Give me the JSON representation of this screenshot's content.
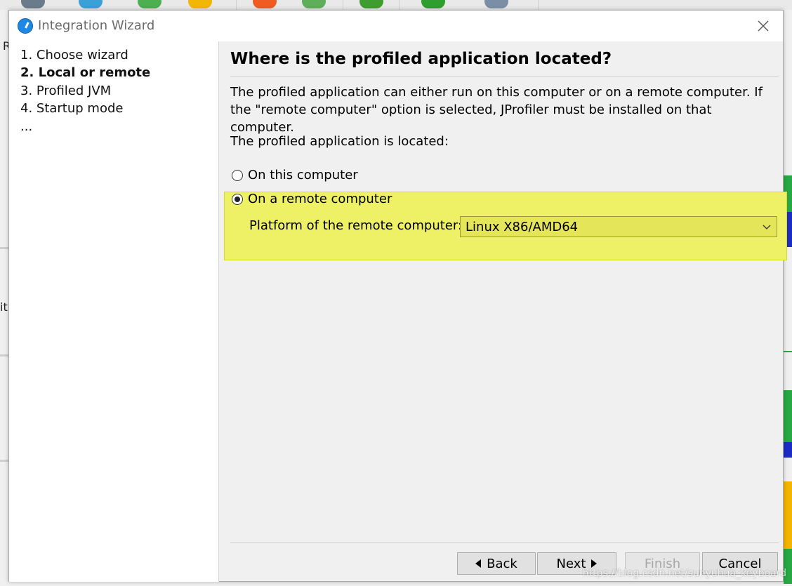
{
  "window": {
    "title": "Integration Wizard"
  },
  "steps": [
    {
      "label": "1. Choose wizard",
      "current": false
    },
    {
      "label": "2. Local or remote",
      "current": true
    },
    {
      "label": "3. Profiled JVM",
      "current": false
    },
    {
      "label": "4. Startup mode",
      "current": false
    },
    {
      "label": "...",
      "current": false
    }
  ],
  "main": {
    "heading": "Where is the profiled application located?",
    "description": "The profiled application can either run on this computer or on a remote computer. If the \"remote computer\" option is selected, JProfiler must be installed on that computer.",
    "located_label": "The profiled application is located:",
    "options": [
      {
        "label": "On this computer",
        "selected": false
      },
      {
        "label": "On a remote computer",
        "selected": true
      }
    ],
    "platform_label": "Platform of the remote computer:",
    "platform_value": "Linux X86/AMD64"
  },
  "buttons": {
    "back": "Back",
    "next": "Next",
    "finish": "Finish",
    "cancel": "Cancel"
  },
  "background": {
    "side_letters": [
      "R",
      "it"
    ]
  },
  "watermark": "https://blog.csdn.net/sunyuhua_keyboard",
  "colors": {
    "highlight": "#eef065",
    "accent_icon": "#1e88e5"
  }
}
